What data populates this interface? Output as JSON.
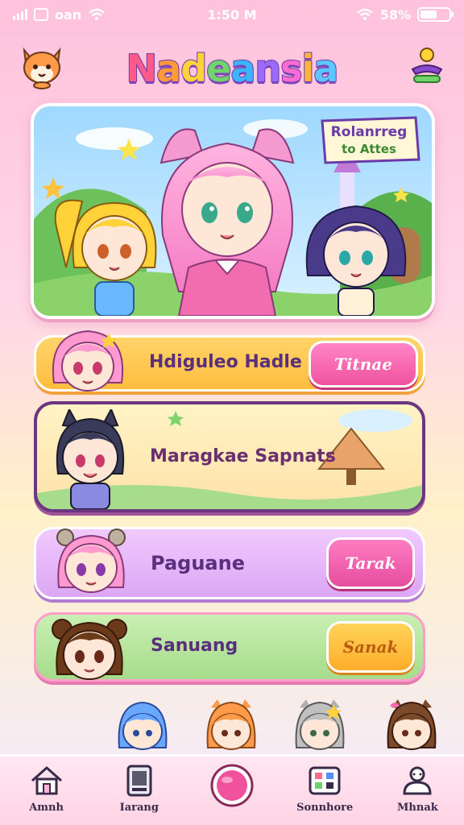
{
  "status_bar": {
    "carrier": "oan",
    "time": "1:50 M",
    "battery": "58%",
    "battery_level": 0.58
  },
  "header": {
    "title": "Nadeansia",
    "title_colors": [
      "#ff5a8a",
      "#ff9a3a",
      "#ffd23a",
      "#6fd46a",
      "#3ab6ff",
      "#9b6bff",
      "#ff6bd0",
      "#ffb43a",
      "#5ac8ff"
    ]
  },
  "banner": {
    "tag_line1": "Rolanrreg",
    "tag_line2": "to Attes"
  },
  "cards": [
    {
      "label": "Hdiguleo Hadle",
      "cta": "Titnae"
    },
    {
      "label": "Maragkae Sapnats"
    },
    {
      "label": "Paguane",
      "cta": "Tarak"
    },
    {
      "label": "Sanuang",
      "cta": "Sanak"
    }
  ],
  "tabs": [
    {
      "label": "Amnh",
      "icon": "house-icon"
    },
    {
      "label": "Iarang",
      "icon": "device-icon"
    },
    {
      "label": "",
      "icon": "center-button-icon"
    },
    {
      "label": "Sonnhore",
      "icon": "grid-icon"
    },
    {
      "label": "Mhnak",
      "icon": "chat-icon"
    }
  ],
  "colors": {
    "accent_pink": "#f0529e",
    "accent_yellow": "#ffbd3e",
    "accent_purple": "#6a3aa8",
    "accent_green": "#a6dc8b"
  }
}
